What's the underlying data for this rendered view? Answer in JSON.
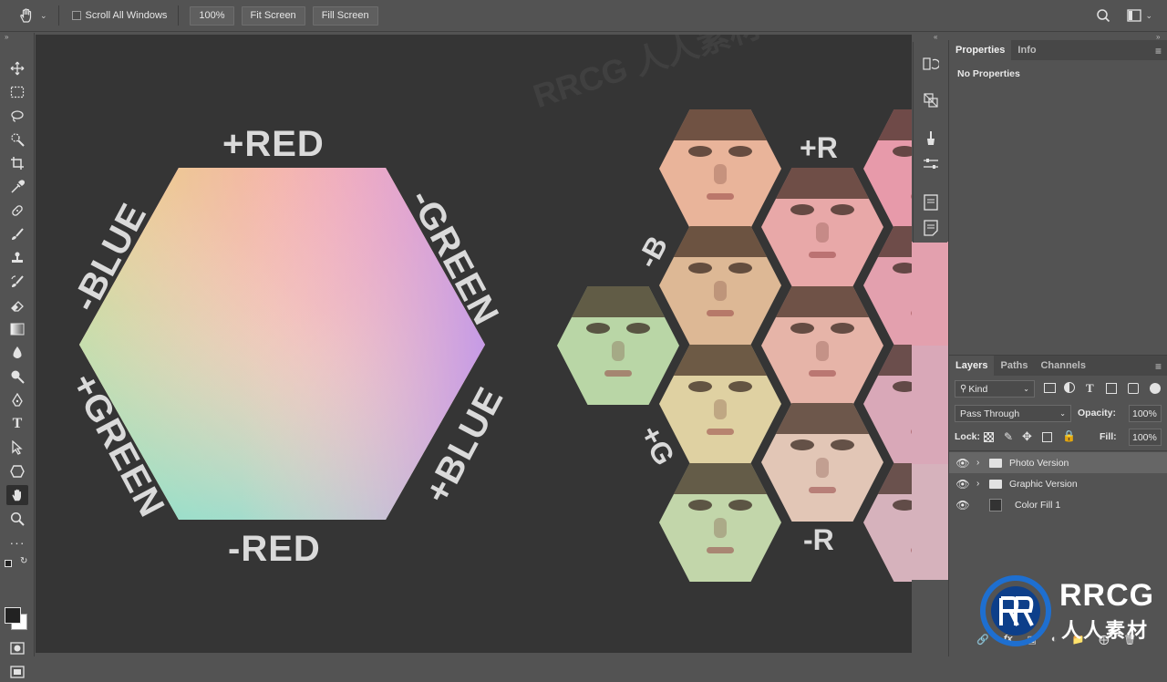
{
  "colors": {
    "ui_bg": "#535353",
    "canvas_bg": "#353535",
    "label_text": "#dadada"
  },
  "options_bar": {
    "hand_tool_icon": "hand-icon",
    "scroll_all_label": "Scroll All Windows",
    "zoom_label": "100%",
    "fit_screen_label": "Fit Screen",
    "fill_screen_label": "Fill Screen",
    "right_icons": [
      "search-icon",
      "workspace-icon",
      "menu-icon"
    ]
  },
  "tools": [
    "move-icon",
    "marquee-icon",
    "lasso-icon",
    "quick-select-icon",
    "crop-icon",
    "eyedropper-icon",
    "healing-icon",
    "brush-icon",
    "stamp-icon",
    "history-brush-icon",
    "eraser-icon",
    "gradient-icon",
    "blur-icon",
    "dodge-icon",
    "pen-icon",
    "type-icon",
    "path-select-icon",
    "shape-icon",
    "hand-icon",
    "zoom-icon",
    "more-tools-icon",
    "default-colors-icon",
    "swap-colors-icon",
    "foreground-color-icon",
    "quick-mask-icon",
    "screen-mode-icon"
  ],
  "canvas": {
    "color_wheel_labels": {
      "top": "+RED",
      "bottom": "-RED",
      "upper_left": "-BLUE",
      "upper_right": "-GREEN",
      "lower_left": "+GREEN",
      "lower_right": "+BLUE"
    },
    "face_labels": {
      "top": "+R",
      "bottom": "-R",
      "left_top": "-B",
      "left_bottom": "+G"
    },
    "watermark": "RRCG 人人素材"
  },
  "strip_icons": [
    "history-icon",
    "transform-icon",
    "brush-settings-icon",
    "adjustments-icon",
    "libraries-icon",
    "notes-icon"
  ],
  "properties_panel": {
    "tabs": [
      {
        "label": "Properties",
        "active": true
      },
      {
        "label": "Info",
        "active": false
      }
    ],
    "body_text": "No Properties"
  },
  "layers_panel": {
    "tabs": [
      {
        "label": "Layers",
        "active": true
      },
      {
        "label": "Paths",
        "active": false
      },
      {
        "label": "Channels",
        "active": false
      }
    ],
    "filter_kind": "Kind",
    "blend_mode": "Pass Through",
    "opacity_label": "Opacity:",
    "opacity_value": "100%",
    "lock_label": "Lock:",
    "fill_label": "Fill:",
    "fill_value": "100%",
    "layers": [
      {
        "name": "Photo Version",
        "type": "group",
        "visible": true,
        "selected": true
      },
      {
        "name": "Graphic Version",
        "type": "group",
        "visible": true,
        "selected": false
      },
      {
        "name": "Color Fill 1",
        "type": "fill",
        "visible": true,
        "selected": false
      }
    ],
    "footer_icons": [
      "link-icon",
      "fx-icon",
      "mask-icon",
      "adjustment-layer-icon",
      "group-icon",
      "new-layer-icon",
      "delete-icon"
    ]
  },
  "logo": {
    "text_main": "RRCG",
    "text_sub": "人人素材"
  }
}
